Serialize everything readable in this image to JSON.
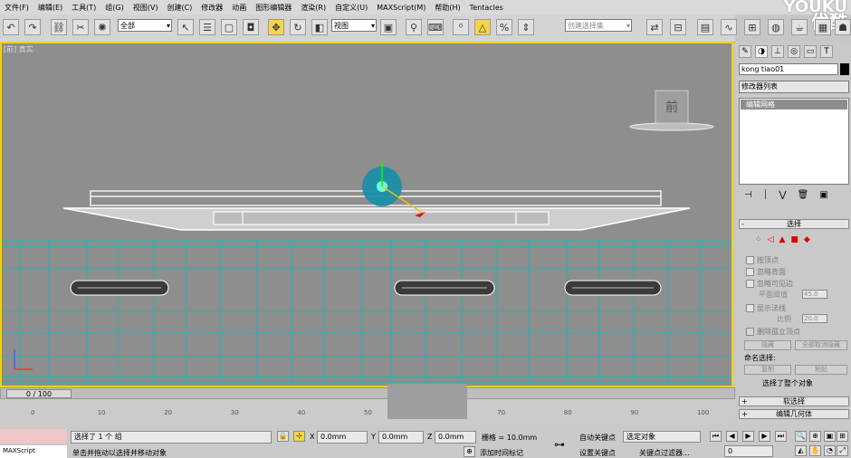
{
  "menu": [
    "文件(F)",
    "编辑(E)",
    "工具(T)",
    "组(G)",
    "视图(V)",
    "创建(C)",
    "修改器",
    "动画",
    "图形编辑器",
    "渲染(R)",
    "自定义(U)",
    "MAXScript(M)",
    "帮助(H)",
    "Tentacles"
  ],
  "watermark": {
    "brand": "YOUKU",
    "sub": "优酷"
  },
  "toolbar": {
    "selection_filter": "全部",
    "ref_coord": "视图",
    "named_selection": "创建选择集"
  },
  "viewport": {
    "label": "[前] 真实",
    "viewcube_label": "前"
  },
  "panel": {
    "object_name": "kong tiao01",
    "modifier_list": "修改器列表",
    "stack_item": "编辑网格",
    "selection_rollout": "选择",
    "checks": [
      "按顶点",
      "忽略背面",
      "忽略可见边",
      "显示法线",
      "删除孤立顶点"
    ],
    "planar_label": "平面阈值",
    "planar_value": "45.0",
    "scale_label": "比例",
    "scale_value": "20.0",
    "hide_btn": "隐藏",
    "unhide_btn": "全部取消隐藏",
    "named_sel_label": "命名选择:",
    "copy_btn": "复制",
    "paste_btn": "粘贴",
    "sel_status": "选择了整个对象",
    "soft_rollout": "软选择",
    "edit_geom_rollout": "编辑几何体"
  },
  "timeline": {
    "frame": "0 / 100",
    "ticks": [
      "0",
      "10",
      "20",
      "30",
      "40",
      "50",
      "60",
      "70",
      "80",
      "90",
      "100"
    ]
  },
  "status": {
    "maxscript": "MAXScript",
    "selected": "选择了 1 个 组",
    "prompt": "单击并拖动以选择并移动对象",
    "x": "0.0mm",
    "y": "0.0mm",
    "z": "0.0mm",
    "grid": "栅格 = 10.0mm",
    "add_tag": "添加时间标记",
    "autokey": "自动关键点",
    "setkey": "设置关键点",
    "key_dropdown": "选定对象",
    "key_filters": "关键点过滤器...",
    "frame_field": "0"
  },
  "colors": {
    "viewport_bg": "#8e8e8e",
    "grid": "#1fb8b0",
    "active_border": "#f1d300"
  }
}
